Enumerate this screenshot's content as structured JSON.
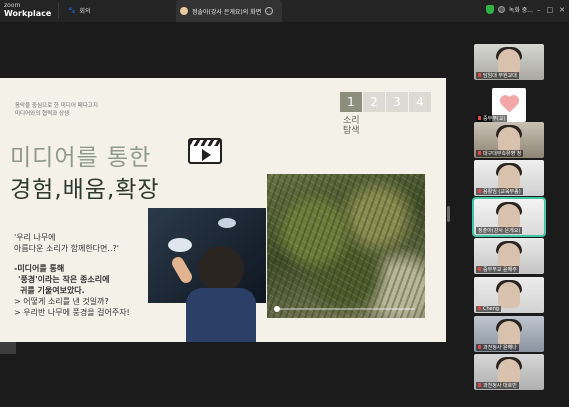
{
  "app": {
    "brand_top": "zoom",
    "brand_bottom": "Workplace",
    "meeting_label": "회의",
    "share_tab_label": "정솔아(강사 은게요)의 화면",
    "record_label": "녹화 중...",
    "accent": "#41c7a4",
    "security_color": "#2fb344"
  },
  "slide": {
    "subtitle_a": "음악을 중심으로 한 미디어 페다고지",
    "subtitle_b": "미디어와의 협력과 상생",
    "title_line1": "미디어를 통한",
    "title_line2": "경험,배움,확장",
    "steps": [
      "1",
      "2",
      "3",
      "4"
    ],
    "active_step": "1",
    "step_label_1": "소리",
    "step_label_2": "탐색",
    "body": {
      "q1": "'우리 나무에",
      "q2": "아름다운 소리가 함께한다면..?'",
      "h1": "-미디어를 통해",
      "h2": "'풍경'이라는 작은 종소리에",
      "h3": "귀를 기울여보았다.",
      "b1": "> 어떻게 소리를 낸 것일까?",
      "b2": "> 우리반 나무에 풍경을 걸어주자!"
    },
    "video_progress": 0.0
  },
  "gallery": [
    {
      "name": "담임대 부원교대"
    },
    {
      "name": "중부부(교)"
    },
    {
      "name": "대구대부속유영 정"
    },
    {
      "name": "용활임 (교육부종)"
    },
    {
      "name": "정솔아(강사 은게요)"
    },
    {
      "name": "중부부교 윤해주"
    },
    {
      "name": "Cheng"
    },
    {
      "name": "과천청사 윤해나"
    },
    {
      "name": "과천청사 대호빈"
    }
  ]
}
